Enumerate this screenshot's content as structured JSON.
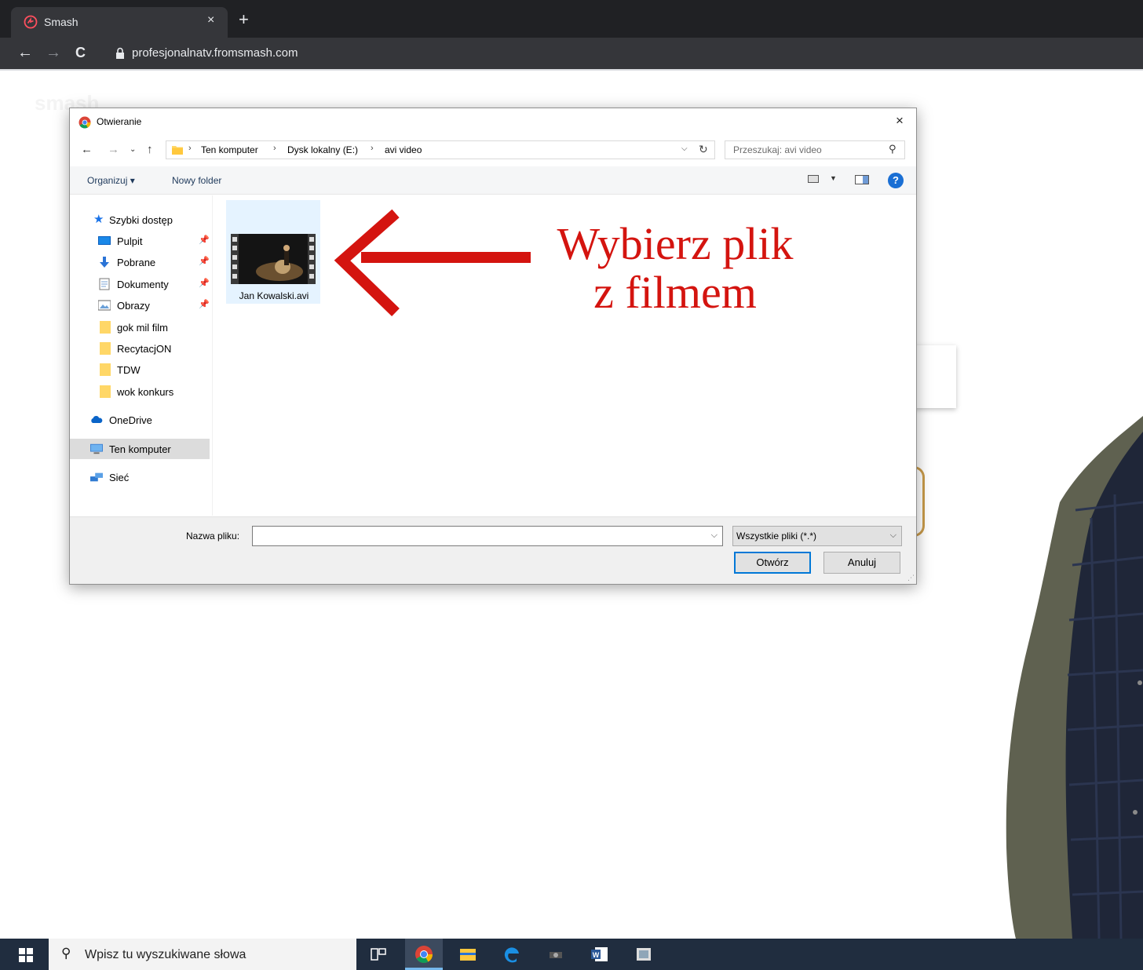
{
  "browser": {
    "tab_title": "Smash",
    "tab_close": "×",
    "new_tab": "+",
    "url": "profesjonalnatv.fromsmash.com",
    "back": "←",
    "forward": "→",
    "reload": "C"
  },
  "page": {
    "bg_logo": "smash"
  },
  "dialog": {
    "title": "Otwieranie",
    "close": "×",
    "path": [
      "Ten komputer",
      "Dysk lokalny (E:)",
      "avi video"
    ],
    "path_sep": "›",
    "search_placeholder": "Przeszukaj: avi video",
    "commands": {
      "organize": "Organizuj ▾",
      "new_folder": "Nowy folder"
    },
    "nav": [
      {
        "label": "Szybki dostęp",
        "icon": "star-icon",
        "pinned": false
      },
      {
        "label": "Pulpit",
        "icon": "desktop-icon",
        "pinned": true
      },
      {
        "label": "Pobrane",
        "icon": "download-icon",
        "pinned": true
      },
      {
        "label": "Dokumenty",
        "icon": "document-icon",
        "pinned": true
      },
      {
        "label": "Obrazy",
        "icon": "pictures-icon",
        "pinned": true
      },
      {
        "label": "gok mil film",
        "icon": "folder-icon",
        "pinned": false
      },
      {
        "label": "RecytacjON",
        "icon": "folder-icon",
        "pinned": false
      },
      {
        "label": "TDW",
        "icon": "folder-icon",
        "pinned": false
      },
      {
        "label": "wok konkurs",
        "icon": "folder-icon",
        "pinned": false
      },
      {
        "label": "OneDrive",
        "icon": "cloud-icon",
        "pinned": false
      },
      {
        "label": "Ten komputer",
        "icon": "computer-icon",
        "pinned": false,
        "selected": true
      },
      {
        "label": "Sieć",
        "icon": "network-icon",
        "pinned": false
      }
    ],
    "files": [
      {
        "name": "Jan Kowalski.avi",
        "icon": "video-file-icon"
      }
    ],
    "filename_label": "Nazwa pliku:",
    "filename_value": "",
    "filetype": "Wszystkie pliki (*.*)",
    "open_button": "Otwórz",
    "cancel_button": "Anuluj"
  },
  "annotation": {
    "line1": "Wybierz plik",
    "line2": "z filmem",
    "color": "#d4140f"
  },
  "taskbar": {
    "search_placeholder": "Wpisz tu wyszukiwane słowa"
  },
  "colors": {
    "chrome_dark": "#202124",
    "chrome_toolbar": "#35363a",
    "taskbar": "#202d3f",
    "accent": "#0078d7"
  }
}
